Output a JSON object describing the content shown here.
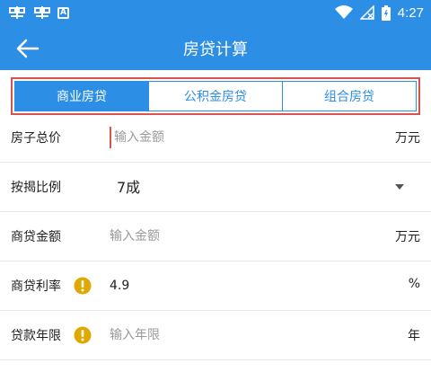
{
  "status_bar": {
    "time": "4:27",
    "icons": [
      "bug-icon",
      "bug-icon",
      "a-notification-icon",
      "wifi-icon",
      "no-signal-icon",
      "battery-icon"
    ],
    "a_icon_text": "A"
  },
  "app_bar": {
    "title": "房贷计算",
    "back_icon": "back-arrow-icon"
  },
  "colors": {
    "primary": "#2d8ee6",
    "highlight_border": "#d9534f",
    "warning": "#e0a800"
  },
  "tabs": [
    {
      "label": "商业房贷",
      "active": true
    },
    {
      "label": "公积金房贷",
      "active": false
    },
    {
      "label": "组合房贷",
      "active": false
    }
  ],
  "form": {
    "total_price": {
      "label": "房子总价",
      "placeholder": "输入金额",
      "value": "",
      "unit": "万元"
    },
    "down_payment_ratio": {
      "label": "按揭比例",
      "selected": "7成"
    },
    "loan_amount": {
      "label": "商贷金额",
      "placeholder": "输入金额",
      "value": "",
      "unit": "万元"
    },
    "interest_rate": {
      "label": "商贷利率",
      "value": "4.9",
      "unit": "%",
      "icon": "warning-icon"
    },
    "loan_term": {
      "label": "贷款年限",
      "placeholder": "输入年限",
      "value": "",
      "unit": "年",
      "icon": "warning-icon"
    }
  }
}
